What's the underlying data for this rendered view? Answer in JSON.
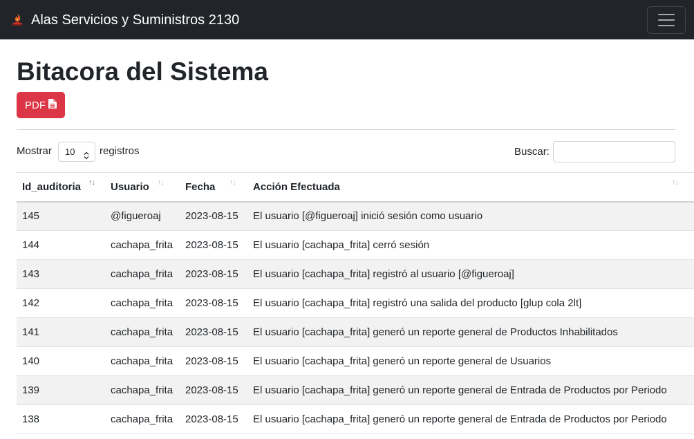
{
  "navbar": {
    "brand": "Alas Servicios y Suministros 2130",
    "brand_icon": "flame-logo-icon",
    "toggler_icon": "hamburger-menu-icon"
  },
  "page": {
    "title": "Bitacora del Sistema",
    "pdf_button": "PDF",
    "pdf_icon": "file-pdf-icon",
    "accent_color": "#dc3545"
  },
  "table_controls": {
    "length_prefix": "Mostrar",
    "length_value": "10",
    "length_suffix": "registros",
    "search_label": "Buscar:",
    "search_value": ""
  },
  "table": {
    "columns": [
      "Id_auditoria",
      "Usuario",
      "Fecha",
      "Acción Efectuada"
    ],
    "rows": [
      [
        "145",
        "@figueroaj",
        "2023-08-15",
        "El usuario [@figueroaj] inició sesión como usuario"
      ],
      [
        "144",
        "cachapa_frita",
        "2023-08-15",
        "El usuario [cachapa_frita] cerró sesión"
      ],
      [
        "143",
        "cachapa_frita",
        "2023-08-15",
        "El usuario [cachapa_frita] registró al usuario [@figueroaj]"
      ],
      [
        "142",
        "cachapa_frita",
        "2023-08-15",
        "El usuario [cachapa_frita] registró una salida del producto [glup cola 2lt]"
      ],
      [
        "141",
        "cachapa_frita",
        "2023-08-15",
        "El usuario [cachapa_frita] generó un reporte general de Productos Inhabilitados"
      ],
      [
        "140",
        "cachapa_frita",
        "2023-08-15",
        "El usuario [cachapa_frita] generó un reporte general de Usuarios"
      ],
      [
        "139",
        "cachapa_frita",
        "2023-08-15",
        "El usuario [cachapa_frita] generó un reporte general de Entrada de Productos por Periodo"
      ],
      [
        "138",
        "cachapa_frita",
        "2023-08-15",
        "El usuario [cachapa_frita] generó un reporte general de Entrada de Productos por Periodo"
      ]
    ]
  }
}
